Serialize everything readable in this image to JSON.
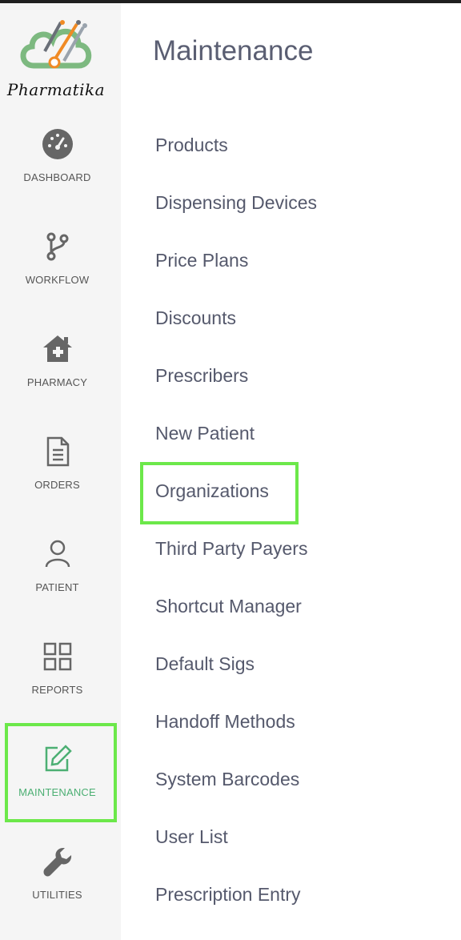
{
  "brand": {
    "name": "Pharmatika"
  },
  "sidebar": {
    "items": [
      {
        "label": "DASHBOARD",
        "icon": "dashboard-icon"
      },
      {
        "label": "WORKFLOW",
        "icon": "workflow-icon"
      },
      {
        "label": "PHARMACY",
        "icon": "pharmacy-icon"
      },
      {
        "label": "ORDERS",
        "icon": "orders-icon"
      },
      {
        "label": "PATIENT",
        "icon": "patient-icon"
      },
      {
        "label": "REPORTS",
        "icon": "reports-icon"
      },
      {
        "label": "MAINTENANCE",
        "icon": "maintenance-icon",
        "active": true
      },
      {
        "label": "UTILITIES",
        "icon": "utilities-icon"
      }
    ]
  },
  "main": {
    "title": "Maintenance",
    "items": [
      "Products",
      "Dispensing Devices",
      "Price Plans",
      "Discounts",
      "Prescribers",
      "New Patient",
      "Organizations",
      "Third Party Payers",
      "Shortcut Manager",
      "Default Sigs",
      "Handoff Methods",
      "System Barcodes",
      "User List",
      "Prescription Entry"
    ]
  },
  "colors": {
    "accent": "#4caf73",
    "highlight": "#6ce84a",
    "text": "#55596c",
    "sidebar_bg": "#f5f5f5"
  }
}
